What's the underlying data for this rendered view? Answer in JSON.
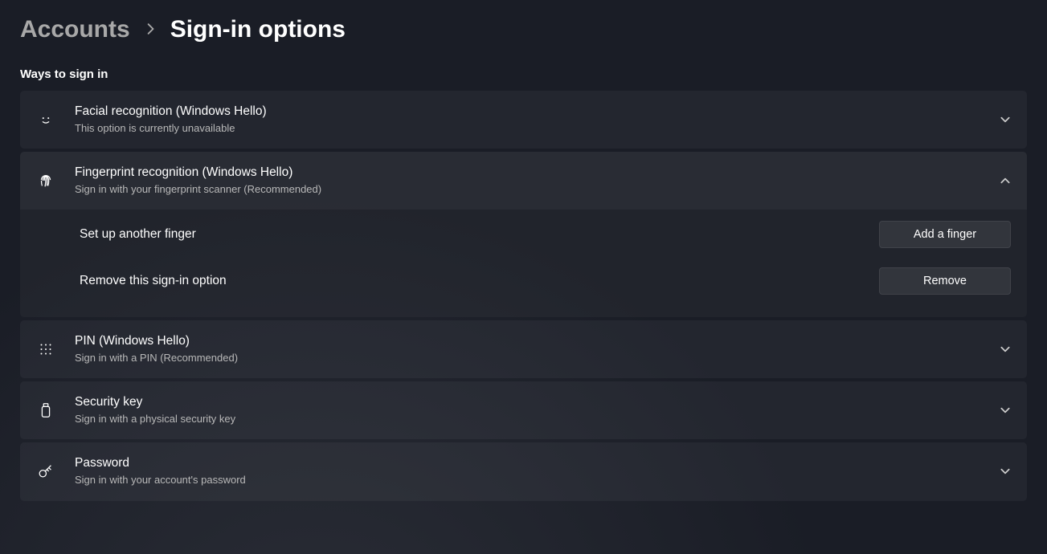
{
  "breadcrumb": {
    "parent": "Accounts",
    "current": "Sign-in options"
  },
  "section_header": "Ways to sign in",
  "options": {
    "facial": {
      "title": "Facial recognition (Windows Hello)",
      "sub": "This option is currently unavailable"
    },
    "fingerprint": {
      "title": "Fingerprint recognition (Windows Hello)",
      "sub": "Sign in with your fingerprint scanner (Recommended)",
      "setup_label": "Set up another finger",
      "add_button": "Add a finger",
      "remove_label": "Remove this sign-in option",
      "remove_button": "Remove"
    },
    "pin": {
      "title": "PIN (Windows Hello)",
      "sub": "Sign in with a PIN (Recommended)"
    },
    "security_key": {
      "title": "Security key",
      "sub": "Sign in with a physical security key"
    },
    "password": {
      "title": "Password",
      "sub": "Sign in with your account's password"
    }
  }
}
